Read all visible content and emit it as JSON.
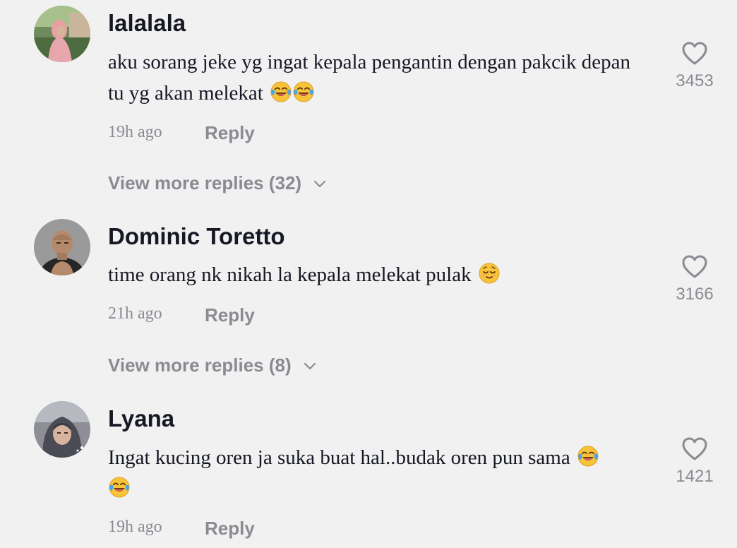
{
  "comments": [
    {
      "username": "lalalala",
      "text": "aku sorang jeke yg ingat kepala pengantin dengan pakcik depan tu yg akan melekat",
      "emoji": "😂😂",
      "time": "19h ago",
      "reply_label": "Reply",
      "view_more": "View more replies (32)",
      "likes": "3453"
    },
    {
      "username": "Dominic Toretto",
      "text": "time orang nk nikah la kepala melekat pulak",
      "emoji": "😌",
      "time": "21h ago",
      "reply_label": "Reply",
      "view_more": "View more replies (8)",
      "likes": "3166"
    },
    {
      "username": "Lyana",
      "text": "Ingat kucing oren ja suka buat hal..budak oren pun sama",
      "emoji": "😂😂",
      "time": "19h ago",
      "reply_label": "Reply",
      "likes": "1421"
    }
  ],
  "icons": {
    "like": "heart-outline-icon",
    "expand": "chevron-down-icon",
    "laugh_emoji": "face-with-tears-of-joy-icon",
    "relieved_emoji": "relieved-face-icon"
  },
  "colors": {
    "background": "#f1f1f2",
    "primary_text": "#161823",
    "secondary_text": "#8a8b91"
  }
}
